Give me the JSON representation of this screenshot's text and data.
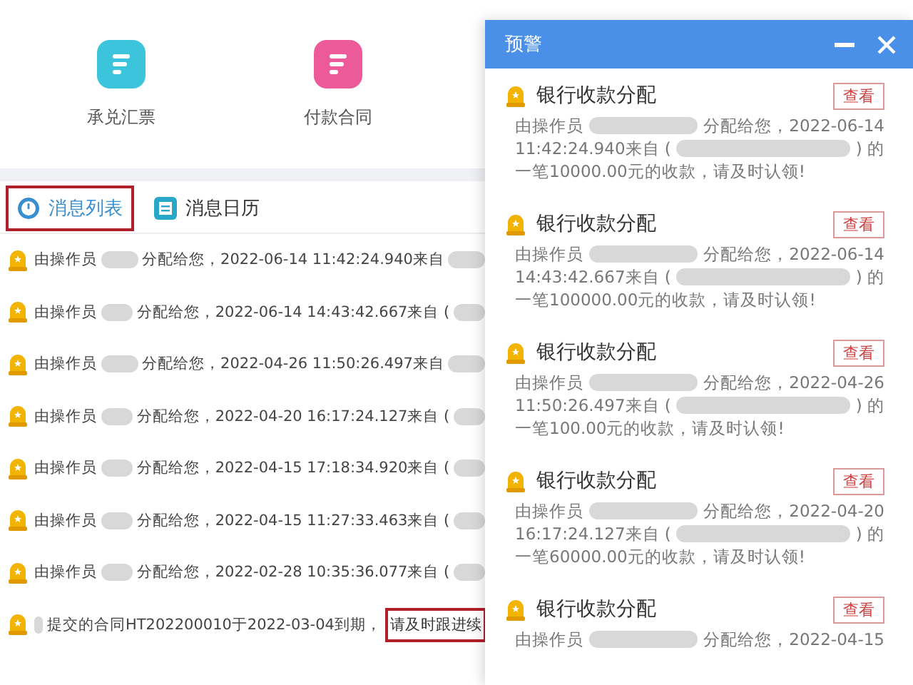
{
  "shortcuts": [
    {
      "label": "承兑汇票",
      "color": "#3cc4dc"
    },
    {
      "label": "付款合同",
      "color": "#ec5a9a"
    }
  ],
  "tabs": [
    {
      "label": "消息列表",
      "selected": true,
      "kind": "clock"
    },
    {
      "label": "消息日历",
      "selected": false,
      "kind": "calendar"
    }
  ],
  "messages": [
    {
      "segments": [
        {
          "kind": "text",
          "text": "由操作员"
        },
        {
          "kind": "redacted"
        },
        {
          "kind": "text",
          "text": "分配给您，2022-06-14 11:42:24.940来自"
        },
        {
          "kind": "redacted"
        }
      ]
    },
    {
      "segments": [
        {
          "kind": "text",
          "text": "由操作员"
        },
        {
          "kind": "redacted"
        },
        {
          "kind": "text",
          "text": "分配给您，2022-06-14 14:43:42.667来自 ("
        },
        {
          "kind": "redacted"
        }
      ]
    },
    {
      "segments": [
        {
          "kind": "text",
          "text": "由操作员"
        },
        {
          "kind": "redacted"
        },
        {
          "kind": "text",
          "text": "分配给您，2022-04-26 11:50:26.497来自"
        },
        {
          "kind": "redacted"
        }
      ]
    },
    {
      "segments": [
        {
          "kind": "text",
          "text": "由操作员"
        },
        {
          "kind": "redacted"
        },
        {
          "kind": "text",
          "text": "分配给您，2022-04-20 16:17:24.127来自 ("
        },
        {
          "kind": "redacted"
        }
      ]
    },
    {
      "segments": [
        {
          "kind": "text",
          "text": "由操作员"
        },
        {
          "kind": "redacted"
        },
        {
          "kind": "text",
          "text": "分配给您，2022-04-15 17:18:34.920来自 ("
        },
        {
          "kind": "redacted"
        }
      ]
    },
    {
      "segments": [
        {
          "kind": "text",
          "text": "由操作员"
        },
        {
          "kind": "redacted"
        },
        {
          "kind": "text",
          "text": "分配给您，2022-04-15 11:27:33.463来自 ("
        },
        {
          "kind": "redacted"
        }
      ]
    },
    {
      "segments": [
        {
          "kind": "text",
          "text": "由操作员"
        },
        {
          "kind": "redacted"
        },
        {
          "kind": "text",
          "text": "分配给您，2022-02-28 10:35:36.077来自 ("
        },
        {
          "kind": "redacted"
        }
      ]
    },
    {
      "segments": [
        {
          "kind": "redacted"
        },
        {
          "kind": "text",
          "text": "提交的合同HT202200010于2022-03-04到期，"
        },
        {
          "kind": "highlight",
          "text": "请及时跟进续"
        }
      ]
    }
  ],
  "popup": {
    "title": "预警",
    "cards": [
      {
        "title": "银行收款分配",
        "button": "查看",
        "lines": [
          [
            {
              "kind": "text",
              "text": "由操作员"
            },
            {
              "kind": "redacted"
            },
            {
              "kind": "text",
              "text": "分配给您，2022-06-14"
            }
          ],
          [
            {
              "kind": "text",
              "text": "11:42:24.940来自 ("
            },
            {
              "kind": "redacted"
            },
            {
              "kind": "text",
              "text": ") 的"
            }
          ],
          [
            {
              "kind": "text",
              "text": "一笔10000.00元的收款，请及时认领!"
            }
          ]
        ]
      },
      {
        "title": "银行收款分配",
        "button": "查看",
        "lines": [
          [
            {
              "kind": "text",
              "text": "由操作员"
            },
            {
              "kind": "redacted"
            },
            {
              "kind": "text",
              "text": "分配给您，2022-06-14"
            }
          ],
          [
            {
              "kind": "text",
              "text": "14:43:42.667来自 ("
            },
            {
              "kind": "redacted"
            },
            {
              "kind": "text",
              "text": ") 的"
            }
          ],
          [
            {
              "kind": "text",
              "text": "一笔100000.00元的收款，请及时认领!"
            }
          ]
        ]
      },
      {
        "title": "银行收款分配",
        "button": "查看",
        "lines": [
          [
            {
              "kind": "text",
              "text": "由操作员"
            },
            {
              "kind": "redacted"
            },
            {
              "kind": "text",
              "text": "分配给您，2022-04-26"
            }
          ],
          [
            {
              "kind": "text",
              "text": "11:50:26.497来自 ("
            },
            {
              "kind": "redacted"
            },
            {
              "kind": "text",
              "text": ") 的"
            }
          ],
          [
            {
              "kind": "text",
              "text": "一笔100.00元的收款，请及时认领!"
            }
          ]
        ]
      },
      {
        "title": "银行收款分配",
        "button": "查看",
        "lines": [
          [
            {
              "kind": "text",
              "text": "由操作员"
            },
            {
              "kind": "redacted"
            },
            {
              "kind": "text",
              "text": "分配给您，2022-04-20"
            }
          ],
          [
            {
              "kind": "text",
              "text": "16:17:24.127来自 ("
            },
            {
              "kind": "redacted"
            },
            {
              "kind": "text",
              "text": ") 的"
            }
          ],
          [
            {
              "kind": "text",
              "text": "一笔60000.00元的收款，请及时认领!"
            }
          ]
        ]
      },
      {
        "title": "银行收款分配",
        "button": "查看",
        "lines": [
          [
            {
              "kind": "text",
              "text": "由操作员"
            },
            {
              "kind": "redacted"
            },
            {
              "kind": "text",
              "text": "分配给您，2022-04-15"
            }
          ]
        ]
      }
    ]
  }
}
